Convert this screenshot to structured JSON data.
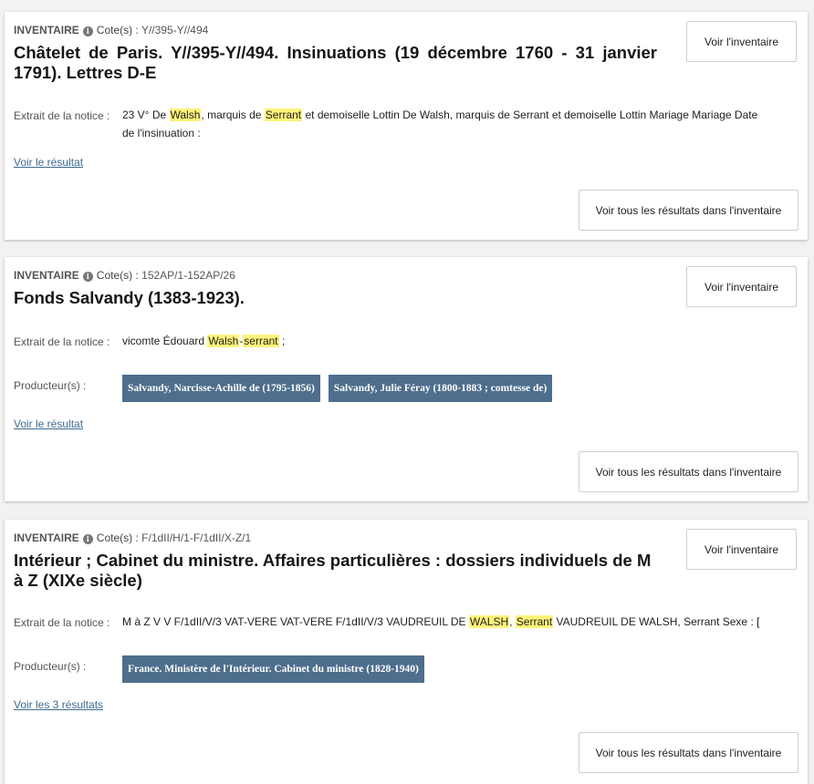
{
  "results": [
    {
      "kind": "INVENTAIRE",
      "cote_label": "Cote(s) :",
      "cote_value": "Y//395-Y//494",
      "title": "Châtelet de Paris. Y//395-Y//494. Insinuations (19 décembre 1760 - 31 janvier 1791). Lettres D-E",
      "voir_inventaire": "Voir l'inventaire",
      "extrait_label": "Extrait de la notice :",
      "extrait": {
        "t1": "23 V° De ",
        "h1": "Walsh",
        "t2": ", marquis de ",
        "h2": "Serrant",
        "t3": " et demoiselle Lottin De Walsh, marquis de Serrant et demoiselle Lottin Mariage Mariage Date de l'insinuation :"
      },
      "result_link": "Voir le résultat",
      "all_results": "Voir tous les résultats dans l'inventaire"
    },
    {
      "kind": "INVENTAIRE",
      "cote_label": "Cote(s) :",
      "cote_value": "152AP/1-152AP/26",
      "title": "Fonds Salvandy (1383-1923).",
      "voir_inventaire": "Voir l'inventaire",
      "extrait_label": "Extrait de la notice :",
      "extrait": {
        "t1": "vicomte Édouard ",
        "h1": "Walsh",
        "t2": "-",
        "h2": "serrant",
        "t3": " ;"
      },
      "producteurs_label": "Producteur(s) :",
      "producteurs": [
        "Salvandy, Narcisse-Achille de (1795-1856)",
        "Salvandy, Julie Féray (1800-1883 ; comtesse de)"
      ],
      "result_link": "Voir le résultat",
      "all_results": "Voir tous les résultats dans l'inventaire"
    },
    {
      "kind": "INVENTAIRE",
      "cote_label": "Cote(s) :",
      "cote_value": "F/1dII/H/1-F/1dII/X-Z/1",
      "title": "Intérieur ; Cabinet du ministre. Affaires particulières : dossiers individuels de M à Z (XIXe siècle)",
      "voir_inventaire": "Voir l'inventaire",
      "extrait_label": "Extrait de la notice :",
      "extrait": {
        "t1": "M à Z V V F/1dII/V/3 VAT-VERE VAT-VERE F/1dII/V/3 VAUDREUIL DE ",
        "h1": "WALSH",
        "t2": ", ",
        "h2": "Serrant",
        "t3": " VAUDREUIL DE WALSH, Serrant Sexe : ["
      },
      "producteurs_label": "Producteur(s) :",
      "producteurs": [
        "France. Ministère de l'Intérieur. Cabinet du ministre (1828-1940)"
      ],
      "result_link": "Voir les 3 résultats",
      "all_results": "Voir tous les résultats dans l'inventaire"
    }
  ],
  "colors": {
    "highlight": "#fff37a",
    "tag_background": "#4d6e8d",
    "link": "#3f6a8f"
  },
  "icons": {
    "info": "info-circle-icon"
  }
}
